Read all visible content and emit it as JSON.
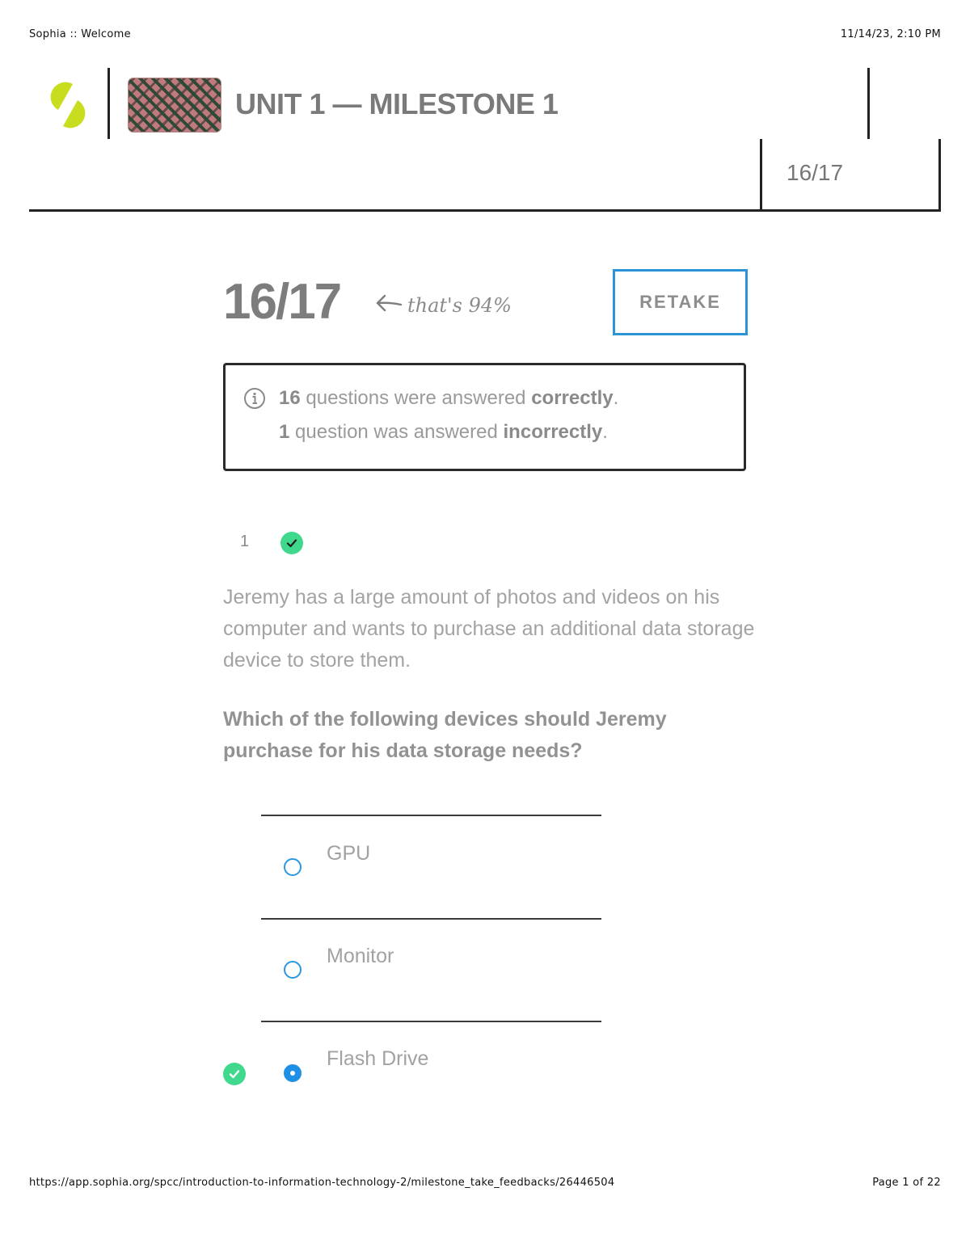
{
  "print_header": {
    "title": "Sophia :: Welcome",
    "datetime": "11/14/23, 2:10 PM"
  },
  "header": {
    "title": "UNIT 1 — MILESTONE 1",
    "score": "16/17"
  },
  "result": {
    "score": "16/17",
    "percent_note": "that's 94%",
    "retake_label": "RETAKE",
    "summary": {
      "correct_count": "16",
      "correct_text": " questions were answered ",
      "correct_word": "correctly",
      "incorrect_count": "1",
      "incorrect_text": " question was answered ",
      "incorrect_word": "incorrectly",
      "period": "."
    }
  },
  "question": {
    "number": "1",
    "status": "correct",
    "text": "Jeremy has a large amount of photos and videos on his computer and wants to purchase an additional data storage device to store them.",
    "prompt": "Which of the following devices should Jeremy purchase for his data storage needs?",
    "options": [
      {
        "label": "GPU",
        "selected": false,
        "correct": false
      },
      {
        "label": "Monitor",
        "selected": false,
        "correct": false
      },
      {
        "label": "Flash Drive",
        "selected": true,
        "correct": true
      }
    ]
  },
  "print_footer": {
    "url": "https://app.sophia.org/spcc/introduction-to-information-technology-2/milestone_take_feedbacks/26446504",
    "page": "Page 1 of 22"
  },
  "colors": {
    "accent_blue": "#2a94d6",
    "correct_green": "#3fd88c",
    "logo_yellow": "#c8dd1e"
  }
}
